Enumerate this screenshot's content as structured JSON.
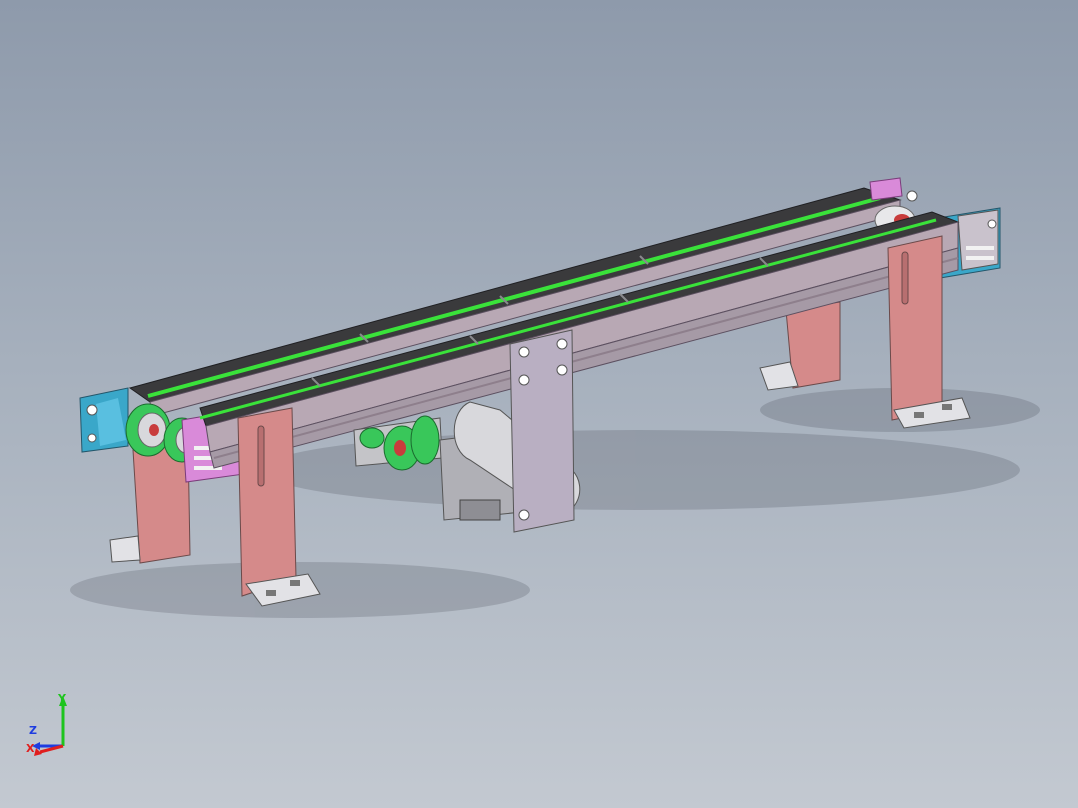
{
  "viewport": {
    "background_top": "#8e9aab",
    "background_bottom": "#c3c9d1"
  },
  "model": {
    "colors": {
      "rail_top": "#3a3a3c",
      "rail_body": "#b8a8b4",
      "rail_shadow": "#8e7f8c",
      "belt": "#3ae23a",
      "leg": "#d58a8a",
      "leg_dark": "#b86f70",
      "foot": "#e2e2e6",
      "bracket_blue": "#3aa7c9",
      "bracket_pink": "#d98ad9",
      "motor_plate": "#b9afc2",
      "motor_arm": "#d8d8dc",
      "gear_green": "#39c75a"
    }
  },
  "triad": {
    "y_label": "Y",
    "z_label": "Z",
    "x_label": "X",
    "y_color": "#1ec41e",
    "x_color": "#e01e1e",
    "z_color": "#1e3ce0"
  }
}
